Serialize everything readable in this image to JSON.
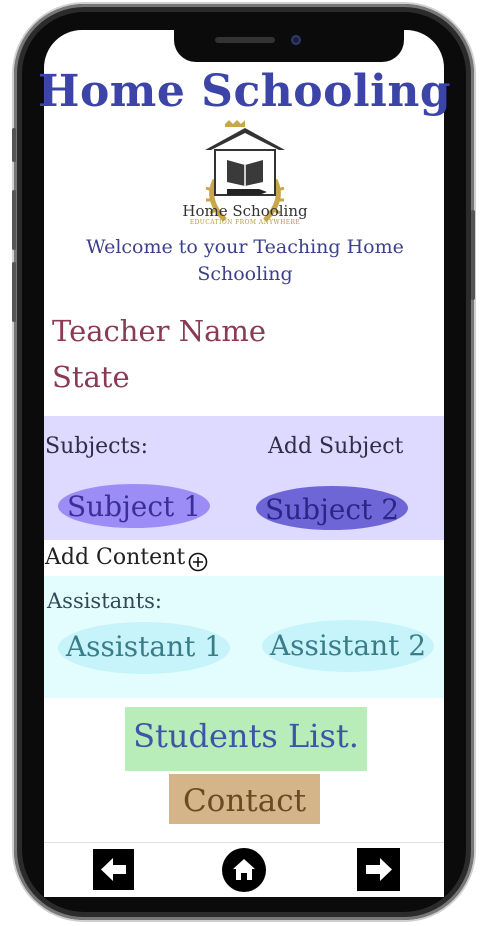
{
  "header": {
    "title": "Home Schooling"
  },
  "logo": {
    "brand": "Home Schooling",
    "tagline": "EDUCATION FROM ANYWHERE"
  },
  "welcome": {
    "line1": "Welcome to your Teaching Home",
    "line2": "Schooling"
  },
  "profile": {
    "teacher_name": "Teacher Name",
    "state": "State"
  },
  "subjects": {
    "label": "Subjects:",
    "add_label": "Add Subject",
    "items": [
      "Subject 1",
      "Subject 2"
    ]
  },
  "content": {
    "add_label": "Add Content"
  },
  "assistants": {
    "label": "Assistants:",
    "items": [
      "Assistant 1",
      "Assistant 2"
    ]
  },
  "actions": {
    "students_list": "Students List.",
    "contact": "Contact"
  },
  "nav": {
    "back_icon": "arrow-left-icon",
    "home_icon": "home-icon",
    "forward_icon": "arrow-right-icon"
  },
  "colors": {
    "title": "#3c44a8",
    "teacher_text": "#8a3a55",
    "subjects_band": "#ded9ff",
    "assistants_band": "#e3fdff",
    "students_button": "#b8ecb8",
    "contact_button": "#d4b58a"
  }
}
